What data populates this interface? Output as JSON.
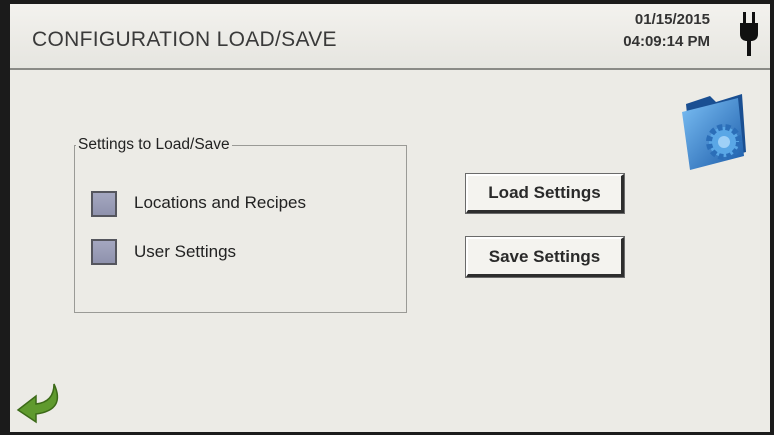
{
  "header": {
    "title": "CONFIGURATION LOAD/SAVE",
    "date": "01/15/2015",
    "time": "04:09:14 PM"
  },
  "settings_group": {
    "label": "Settings to Load/Save",
    "options": [
      {
        "label": "Locations and Recipes",
        "checked": false
      },
      {
        "label": "User Settings",
        "checked": false
      }
    ]
  },
  "buttons": {
    "load": "Load Settings",
    "save": "Save Settings"
  },
  "icons": {
    "power": "power-plug-icon",
    "folder": "folder-gear-icon",
    "back": "back-arrow-icon"
  },
  "colors": {
    "screen_bg": "#ecebe6",
    "checkbox": "#9a9db8",
    "folder_blue": "#2a7fd0",
    "arrow_green": "#5a8a2a"
  }
}
